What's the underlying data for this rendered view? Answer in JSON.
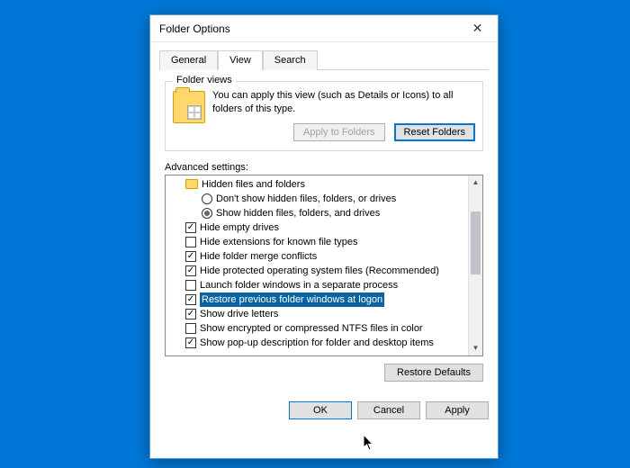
{
  "dialog": {
    "title": "Folder Options"
  },
  "tabs": {
    "general": "General",
    "view": "View",
    "search": "Search",
    "active": "view"
  },
  "folder_views": {
    "group_label": "Folder views",
    "description": "You can apply this view (such as Details or Icons) to all folders of this type.",
    "apply_btn": "Apply to Folders",
    "reset_btn": "Reset Folders"
  },
  "advanced": {
    "label": "Advanced settings:",
    "tree": {
      "hidden_group": "Hidden files and folders",
      "radio_dont_show": "Don't show hidden files, folders, or drives",
      "radio_show": "Show hidden files, folders, and drives",
      "radio_selected": "show"
    },
    "items": [
      {
        "label": "Hide empty drives",
        "checked": true
      },
      {
        "label": "Hide extensions for known file types",
        "checked": false
      },
      {
        "label": "Hide folder merge conflicts",
        "checked": true
      },
      {
        "label": "Hide protected operating system files (Recommended)",
        "checked": true
      },
      {
        "label": "Launch folder windows in a separate process",
        "checked": false
      },
      {
        "label": "Restore previous folder windows at logon",
        "checked": true,
        "selected": true
      },
      {
        "label": "Show drive letters",
        "checked": true
      },
      {
        "label": "Show encrypted or compressed NTFS files in color",
        "checked": false
      },
      {
        "label": "Show pop-up description for folder and desktop items",
        "checked": true
      }
    ]
  },
  "buttons": {
    "restore_defaults": "Restore Defaults",
    "ok": "OK",
    "cancel": "Cancel",
    "apply": "Apply"
  }
}
